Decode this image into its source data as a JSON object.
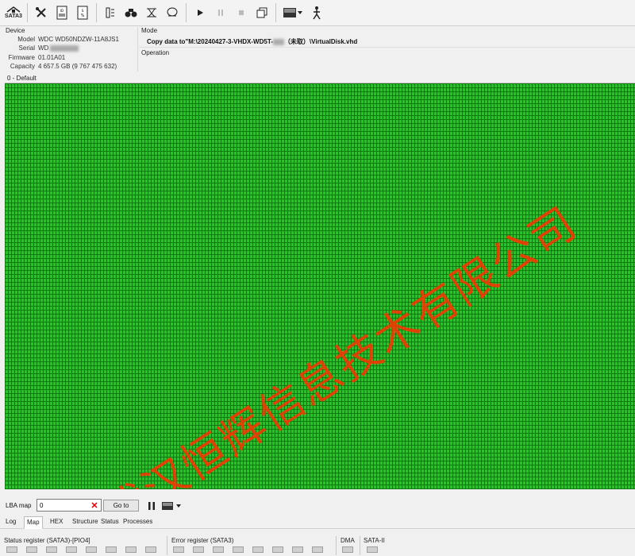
{
  "toolbar": {
    "interface_label": "SATA3",
    "items": [
      {
        "name": "tools-icon"
      },
      {
        "name": "drive-id-icon"
      },
      {
        "name": "smart-icon"
      },
      {
        "name": "sensor-icon"
      },
      {
        "name": "binoculars-icon"
      },
      {
        "name": "erase-icon"
      },
      {
        "name": "drive-settings-icon"
      },
      {
        "name": "play-icon"
      },
      {
        "name": "pause-icon"
      },
      {
        "name": "stop-icon"
      },
      {
        "name": "copy-windows-icon"
      },
      {
        "name": "map-view-icon"
      },
      {
        "name": "run-icon"
      }
    ]
  },
  "device": {
    "title": "Device",
    "model_label": "Model",
    "model_value": "WDC WD50NDZW-11A8JS1",
    "serial_label": "Serial",
    "serial_value": "WD",
    "firmware_label": "Firmware",
    "firmware_value": "01.01A01",
    "capacity_label": "Capacity",
    "capacity_value": "4 657.5 GB (9 767 475 632)"
  },
  "mode": {
    "title": "Mode",
    "value_prefix": "Copy data to\"M:\\20240427-3-VHDX-WD5T-",
    "value_suffix": "（未取）\\VirtualDisk.vhd",
    "operation_label": "Operation"
  },
  "section_label": "0 - Default",
  "watermark_text": "武汉恒辉信息技术有限公司",
  "lba": {
    "label": "LBA map",
    "value": "0",
    "goto_label": "Go to"
  },
  "tabs": [
    "Log",
    "Map",
    "HEX",
    "Structure",
    "Status",
    "Processes"
  ],
  "active_tab": "Map",
  "status": {
    "status_register_label": "Status register (SATA3)-[PIO4]",
    "error_register_label": "Error register (SATA3)",
    "dma_label": "DMA",
    "sata2_label": "SATA-II"
  },
  "colors": {
    "map_green": "#24c624",
    "watermark_red": "#ff3300"
  }
}
